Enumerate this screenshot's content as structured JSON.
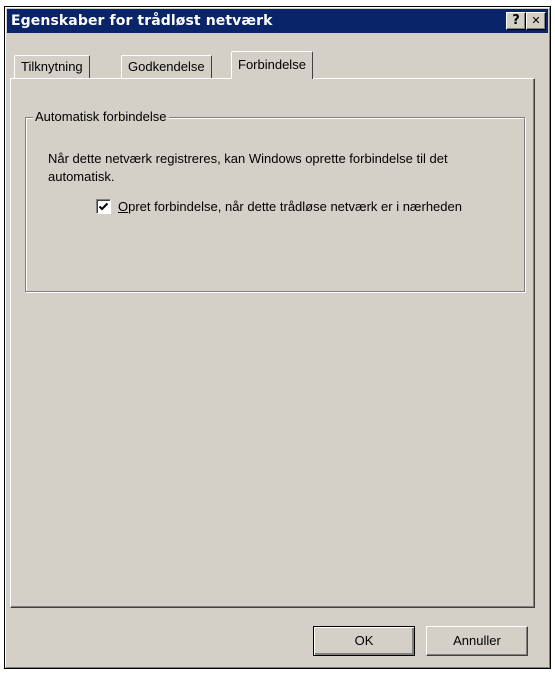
{
  "window": {
    "title": "Egenskaber for trådløst netværk",
    "help_button": "?",
    "close_button": "✕"
  },
  "tabs": [
    {
      "label": "Tilknytning",
      "active": false
    },
    {
      "label": "Godkendelse",
      "active": false
    },
    {
      "label": "Forbindelse",
      "active": true
    }
  ],
  "group": {
    "legend": "Automatisk forbindelse",
    "description": "Når dette netværk registreres, kan Windows oprette forbindelse til det automatisk.",
    "checkbox": {
      "label_first_letter": "O",
      "label_rest": "pret forbindelse, når dette trådløse netværk er i nærheden",
      "checked": true
    }
  },
  "buttons": {
    "ok": "OK",
    "cancel": "Annuller"
  }
}
